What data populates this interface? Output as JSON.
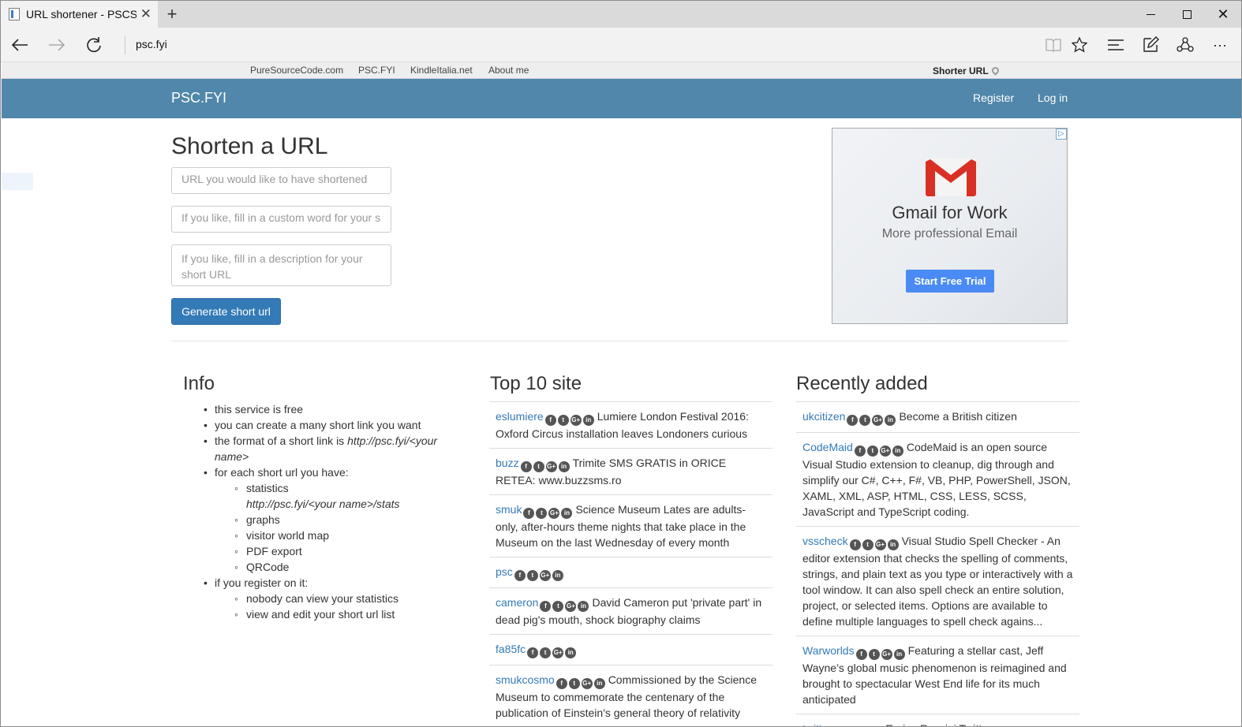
{
  "browser": {
    "tab_title": "URL shortener - PSCShc",
    "address": "psc.fyi"
  },
  "topstrip": {
    "links": [
      "PureSourceCode.com",
      "PSC.FYI",
      "KindleItalia.net",
      "About me"
    ],
    "shorter_url": "Shorter URL"
  },
  "navbar": {
    "brand": "PSC.FYI",
    "register": "Register",
    "login": "Log in"
  },
  "form": {
    "heading": "Shorten a URL",
    "url_placeholder": "URL you would like to have shortened",
    "custom_placeholder": "If you like, fill in a custom word for your s",
    "desc_placeholder": "If you like, fill in a description for your short URL",
    "button": "Generate short url"
  },
  "ad": {
    "title": "Gmail for Work",
    "subtitle": "More professional Email",
    "button": "Start Free Trial",
    "colors": {
      "red": "#d93025",
      "button": "#4a8af4"
    }
  },
  "info": {
    "heading": "Info",
    "items": [
      "this service is free",
      "you can create a many short link you want",
      "the format of a short link is ",
      "for each short url you have:",
      "if you register on it:"
    ],
    "format_example": "http://psc.fyi/<your name>",
    "stats_sub": [
      "statistics",
      "http://psc.fyi/<your name>/stats",
      "graphs",
      "visitor world map",
      "PDF export",
      "QRCode"
    ],
    "register_sub": [
      "nobody can view your statistics",
      "view and edit your short url list"
    ]
  },
  "top10": {
    "heading": "Top 10 site",
    "items": [
      {
        "name": "eslumiere",
        "text": "Lumiere London Festival 2016: Oxford Circus installation leaves Londoners curious"
      },
      {
        "name": "buzz",
        "text": "Trimite SMS GRATIS in ORICE RETEA: www.buzzsms.ro"
      },
      {
        "name": "smuk",
        "text": "Science Museum Lates are adults-only, after-hours theme nights that take place in the Museum on the last Wednesday of every month"
      },
      {
        "name": "psc",
        "text": ""
      },
      {
        "name": "cameron",
        "text": "David Cameron put 'private part' in dead pig's mouth, shock biography claims"
      },
      {
        "name": "fa85fc",
        "text": ""
      },
      {
        "name": "smukcosmo",
        "text": "Commissioned by the Science Museum to commemorate the centenary of the publication of Einstein's general theory of relativity"
      }
    ]
  },
  "recent": {
    "heading": "Recently added",
    "items": [
      {
        "name": "ukcitizen",
        "text": "Become a British citizen"
      },
      {
        "name": "CodeMaid",
        "text": "CodeMaid is an open source Visual Studio extension to cleanup, dig through and simplify our C#, C++, F#, VB, PHP, PowerShell, JSON, XAML, XML, ASP, HTML, CSS, LESS, SCSS, JavaScript and TypeScript coding."
      },
      {
        "name": "vsscheck",
        "text": "Visual Studio Spell Checker - An editor extension that checks the spelling of comments, strings, and plain text as you type or interactively with a tool window. It can also spell check an entire solution, project, or selected items. Options are available to define multiple languages to spell check agains..."
      },
      {
        "name": "Warworlds",
        "text": "Featuring a stellar cast, Jeff Wayne’s global music phenomenon is reimagined and brought to spectacular West End life for its much anticipated"
      },
      {
        "name": "twitter",
        "text": "Enrico Rossini Twitter"
      }
    ]
  },
  "social_icons": [
    "facebook-icon",
    "twitter-icon",
    "googleplus-icon",
    "linkedin-icon"
  ]
}
